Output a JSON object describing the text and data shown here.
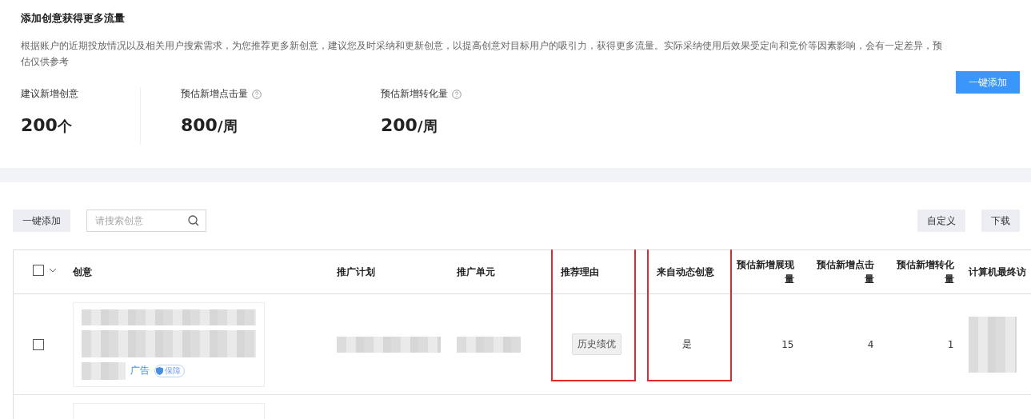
{
  "header": {
    "title": "添加创意获得更多流量",
    "description": "根据账户的近期投放情况以及相关用户搜索需求，为您推荐更多新创意，建议您及时采纳和更新创意，以提高创意对目标用户的吸引力，获得更多流量。实际采纳使用后效果受定向和竞价等因素影响，会有一定差异，预估仅供参考",
    "add_all_button": "一键添加"
  },
  "stats": [
    {
      "label": "建议新增创意",
      "value": "200",
      "unit": "个",
      "help": false
    },
    {
      "label": "预估新增点击量",
      "value": "800",
      "unit": "/周",
      "help": true
    },
    {
      "label": "预估新增转化量",
      "value": "200",
      "unit": "/周",
      "help": true
    }
  ],
  "toolbar": {
    "add_button": "一键添加",
    "search": {
      "placeholder": "请搜索创意"
    },
    "customize_button": "自定义",
    "download_button": "下载"
  },
  "table": {
    "select_all_checked": false,
    "columns": [
      {
        "label": "创意",
        "kind": "text",
        "highlighted": false
      },
      {
        "label": "推广计划",
        "kind": "text",
        "highlighted": false
      },
      {
        "label": "推广单元",
        "kind": "text",
        "highlighted": false
      },
      {
        "label": "推荐理由",
        "kind": "text",
        "highlighted": true
      },
      {
        "label": "来自动态创意",
        "kind": "text",
        "highlighted": true
      },
      {
        "label": "预估新增展现量",
        "kind": "number",
        "highlighted": false
      },
      {
        "label": "预估新增点击量",
        "kind": "number",
        "highlighted": false
      },
      {
        "label": "预估新增转化量",
        "kind": "number",
        "highlighted": false
      },
      {
        "label": "计算机最终访",
        "kind": "text",
        "highlighted": false
      }
    ],
    "rows": [
      {
        "checked": false,
        "ad_label": "广告",
        "badge": "保障",
        "reason": "历史绩优",
        "from_dynamic": "是",
        "impressions": "15",
        "clicks": "4",
        "conversions": "1"
      }
    ]
  }
}
